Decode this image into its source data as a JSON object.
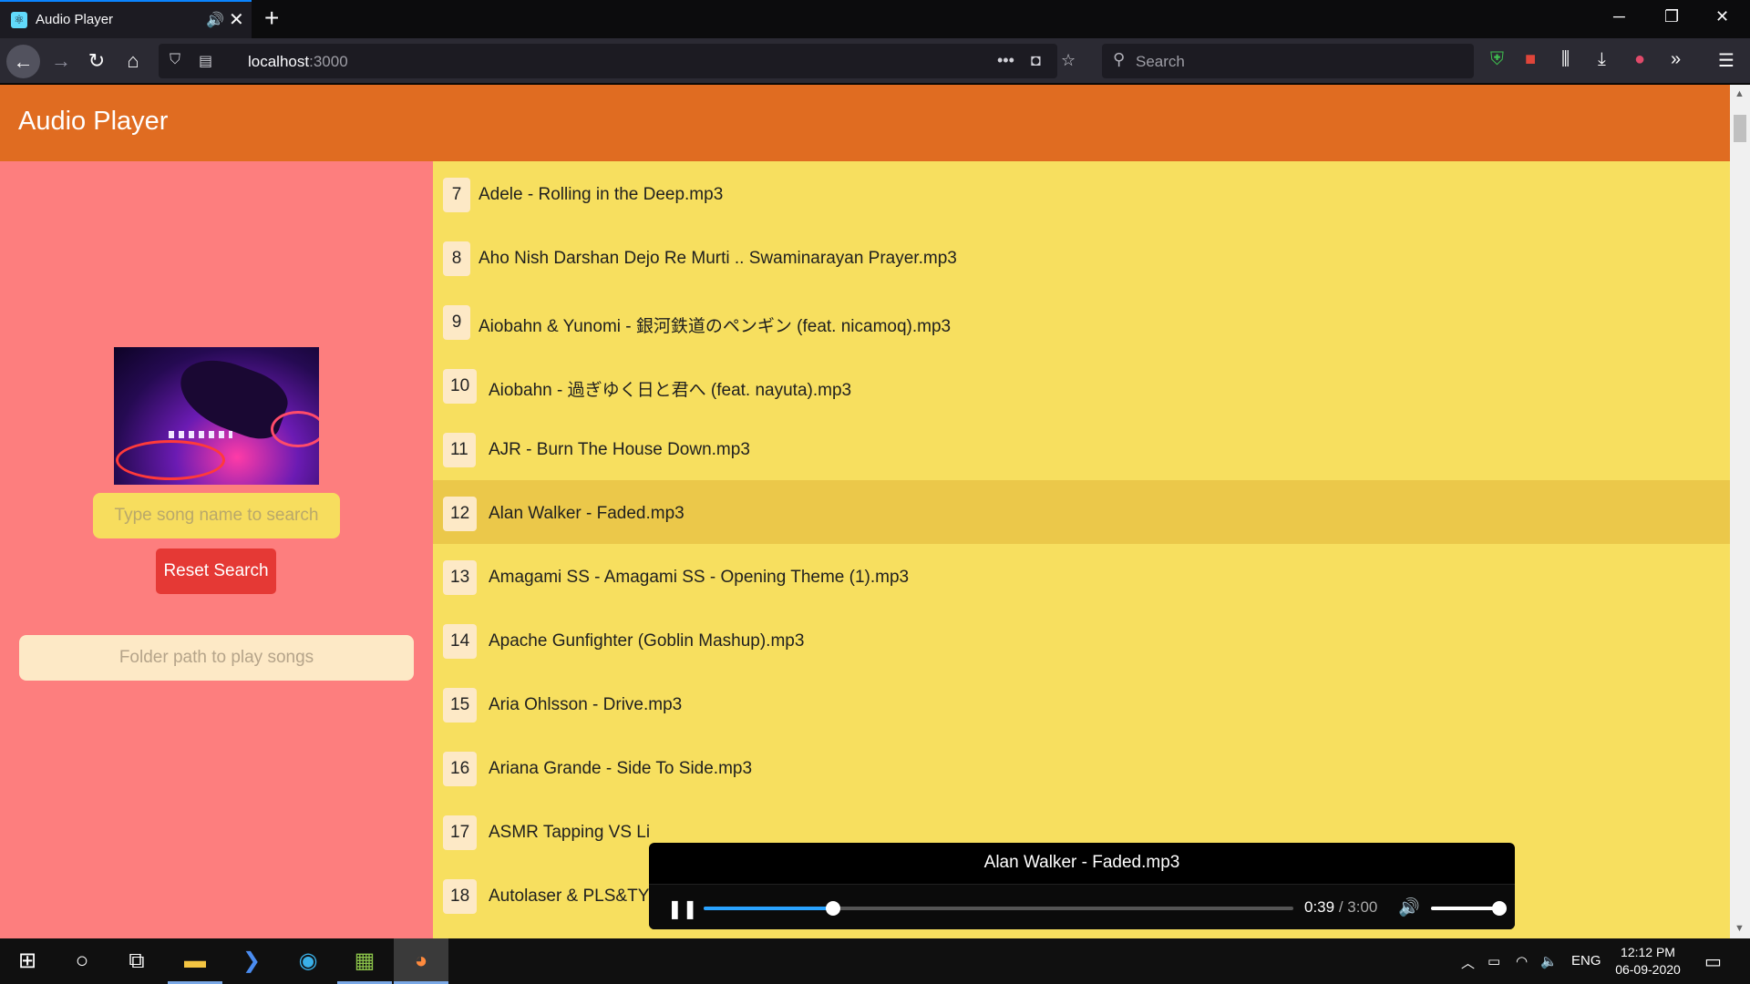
{
  "browser": {
    "tab_title": "Audio Player",
    "tab_audio_icon": "speaker-icon",
    "new_tab": "+",
    "url_host": "localhost",
    "url_port": ":3000",
    "search_placeholder": "Search",
    "window_controls": [
      "─",
      "❐",
      "✕"
    ]
  },
  "app": {
    "title": "Audio Player",
    "search_placeholder": "Type song name to search",
    "reset_label": "Reset Search",
    "folder_placeholder": "Folder path to play songs",
    "colors": {
      "header": "#e06c21",
      "left_pane": "#fd7e7e",
      "list_bg": "#f7df5f",
      "active_row": "#ebc84a",
      "reset_button": "#e53935"
    }
  },
  "songs": [
    {
      "num": "7",
      "name": "Adele - Rolling in the Deep.mp3"
    },
    {
      "num": "8",
      "name": "Aho Nish Darshan Dejo Re Murti .. Swaminarayan Prayer.mp3"
    },
    {
      "num": "9",
      "name": "Aiobahn & Yunomi - 銀河鉄道のペンギン (feat. nicamoq).mp3"
    },
    {
      "num": "10",
      "name": "Aiobahn - 過ぎゆく日と君へ (feat. nayuta).mp3"
    },
    {
      "num": "11",
      "name": "AJR - Burn The House Down.mp3"
    },
    {
      "num": "12",
      "name": "Alan Walker - Faded.mp3",
      "active": true
    },
    {
      "num": "13",
      "name": "Amagami SS - Amagami SS - Opening Theme (1).mp3"
    },
    {
      "num": "14",
      "name": "Apache Gunfighter (Goblin Mashup).mp3"
    },
    {
      "num": "15",
      "name": "Aria Ohlsson - Drive.mp3"
    },
    {
      "num": "16",
      "name": "Ariana Grande - Side To Side.mp3"
    },
    {
      "num": "17",
      "name": "ASMR Tapping VS Li"
    },
    {
      "num": "18",
      "name": "Autolaser & PLS&TY"
    }
  ],
  "player": {
    "now_playing": "Alan Walker - Faded.mp3",
    "current_time": "0:39",
    "separator": " / ",
    "duration": "3:00",
    "progress_fraction": 0.22,
    "volume_fraction": 1.0
  },
  "taskbar": {
    "lang": "ENG",
    "time": "12:12 PM",
    "date": "06-09-2020"
  }
}
